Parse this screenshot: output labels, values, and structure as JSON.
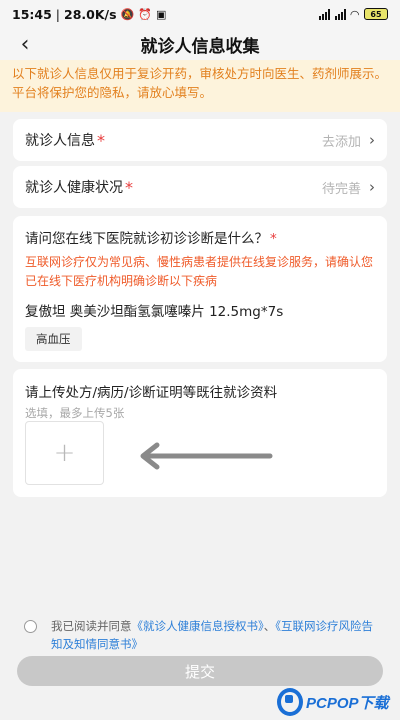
{
  "status_bar": {
    "time": "15:45",
    "speed": "28.0K/s",
    "battery": "65"
  },
  "nav": {
    "back_icon": "‹",
    "title": "就诊人信息收集"
  },
  "notice": {
    "text": "以下就诊人信息仅用于复诊开药，审核处方时向医生、药剂师展示。平台将保护您的隐私，请放心填写。"
  },
  "patient_info": {
    "label": "就诊人信息",
    "required_mark": "*",
    "value": "去添加",
    "chevron": "›"
  },
  "health_status": {
    "label": "就诊人健康状况",
    "required_mark": "*",
    "value": "待完善",
    "chevron": "›"
  },
  "diagnosis": {
    "question": "请问您在线下医院就诊初诊诊断是什么？",
    "required_mark": "*",
    "note": "互联网诊疗仅为常见病、慢性病患者提供在线复诊服务，请确认您已在线下医疗机构明确诊断以下疾病",
    "drug": "复傲坦 奥美沙坦酯氢氯噻嗪片 12.5mg*7s",
    "tag": "高血压"
  },
  "upload": {
    "title": "请上传处方/病历/诊断证明等既往就诊资料",
    "hint": "选填，最多上传5张",
    "add_symbol": "+"
  },
  "agreement": {
    "prefix": "我已阅读并同意",
    "link1": "《就诊人健康信息授权书》",
    "sep": "、",
    "link2": "《互联网诊疗风险告知及知情同意书》"
  },
  "submit": {
    "label": "提交"
  },
  "watermark": {
    "text": "PCPOP下载"
  },
  "colors": {
    "notice_bg": "#fdf3dc",
    "notice_text": "#e2801f",
    "required": "#e83c3c",
    "link": "#2f80d8",
    "submit_disabled": "#c8c8c8"
  }
}
